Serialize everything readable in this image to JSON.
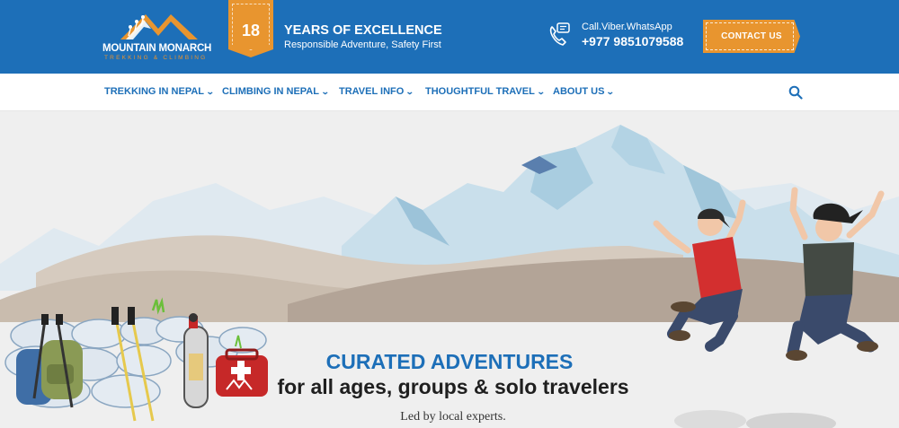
{
  "brand": {
    "name": "MOUNTAIN MONARCH",
    "tagline": "TREKKING & CLIMBING"
  },
  "badge": {
    "years": "18"
  },
  "excellence": {
    "title": "YEARS OF EXCELLENCE",
    "subtitle": "Responsible Adventure, Safety First"
  },
  "contact": {
    "channels": "Call.Viber.WhatsApp",
    "phone": "+977 9851079588",
    "button_label": "CONTACT US"
  },
  "nav": {
    "items": [
      {
        "label": "TREKKING IN NEPAL"
      },
      {
        "label": "CLIMBING IN NEPAL"
      },
      {
        "label": "TRAVEL INFO"
      },
      {
        "label": "THOUGHTFUL TRAVEL"
      },
      {
        "label": "ABOUT US"
      }
    ],
    "chevron": "⌄"
  },
  "hero": {
    "title": "CURATED ADVENTURES",
    "subtitle": "for all ages, groups & solo travelers",
    "note": "Led by local experts."
  },
  "colors": {
    "primary_blue": "#1d6fb8",
    "accent_orange": "#e8952f",
    "hero_background": "#efefef"
  },
  "icons": [
    "logo-mountain-icon",
    "phone-chat-icon",
    "chevron-down-icon",
    "search-icon"
  ]
}
